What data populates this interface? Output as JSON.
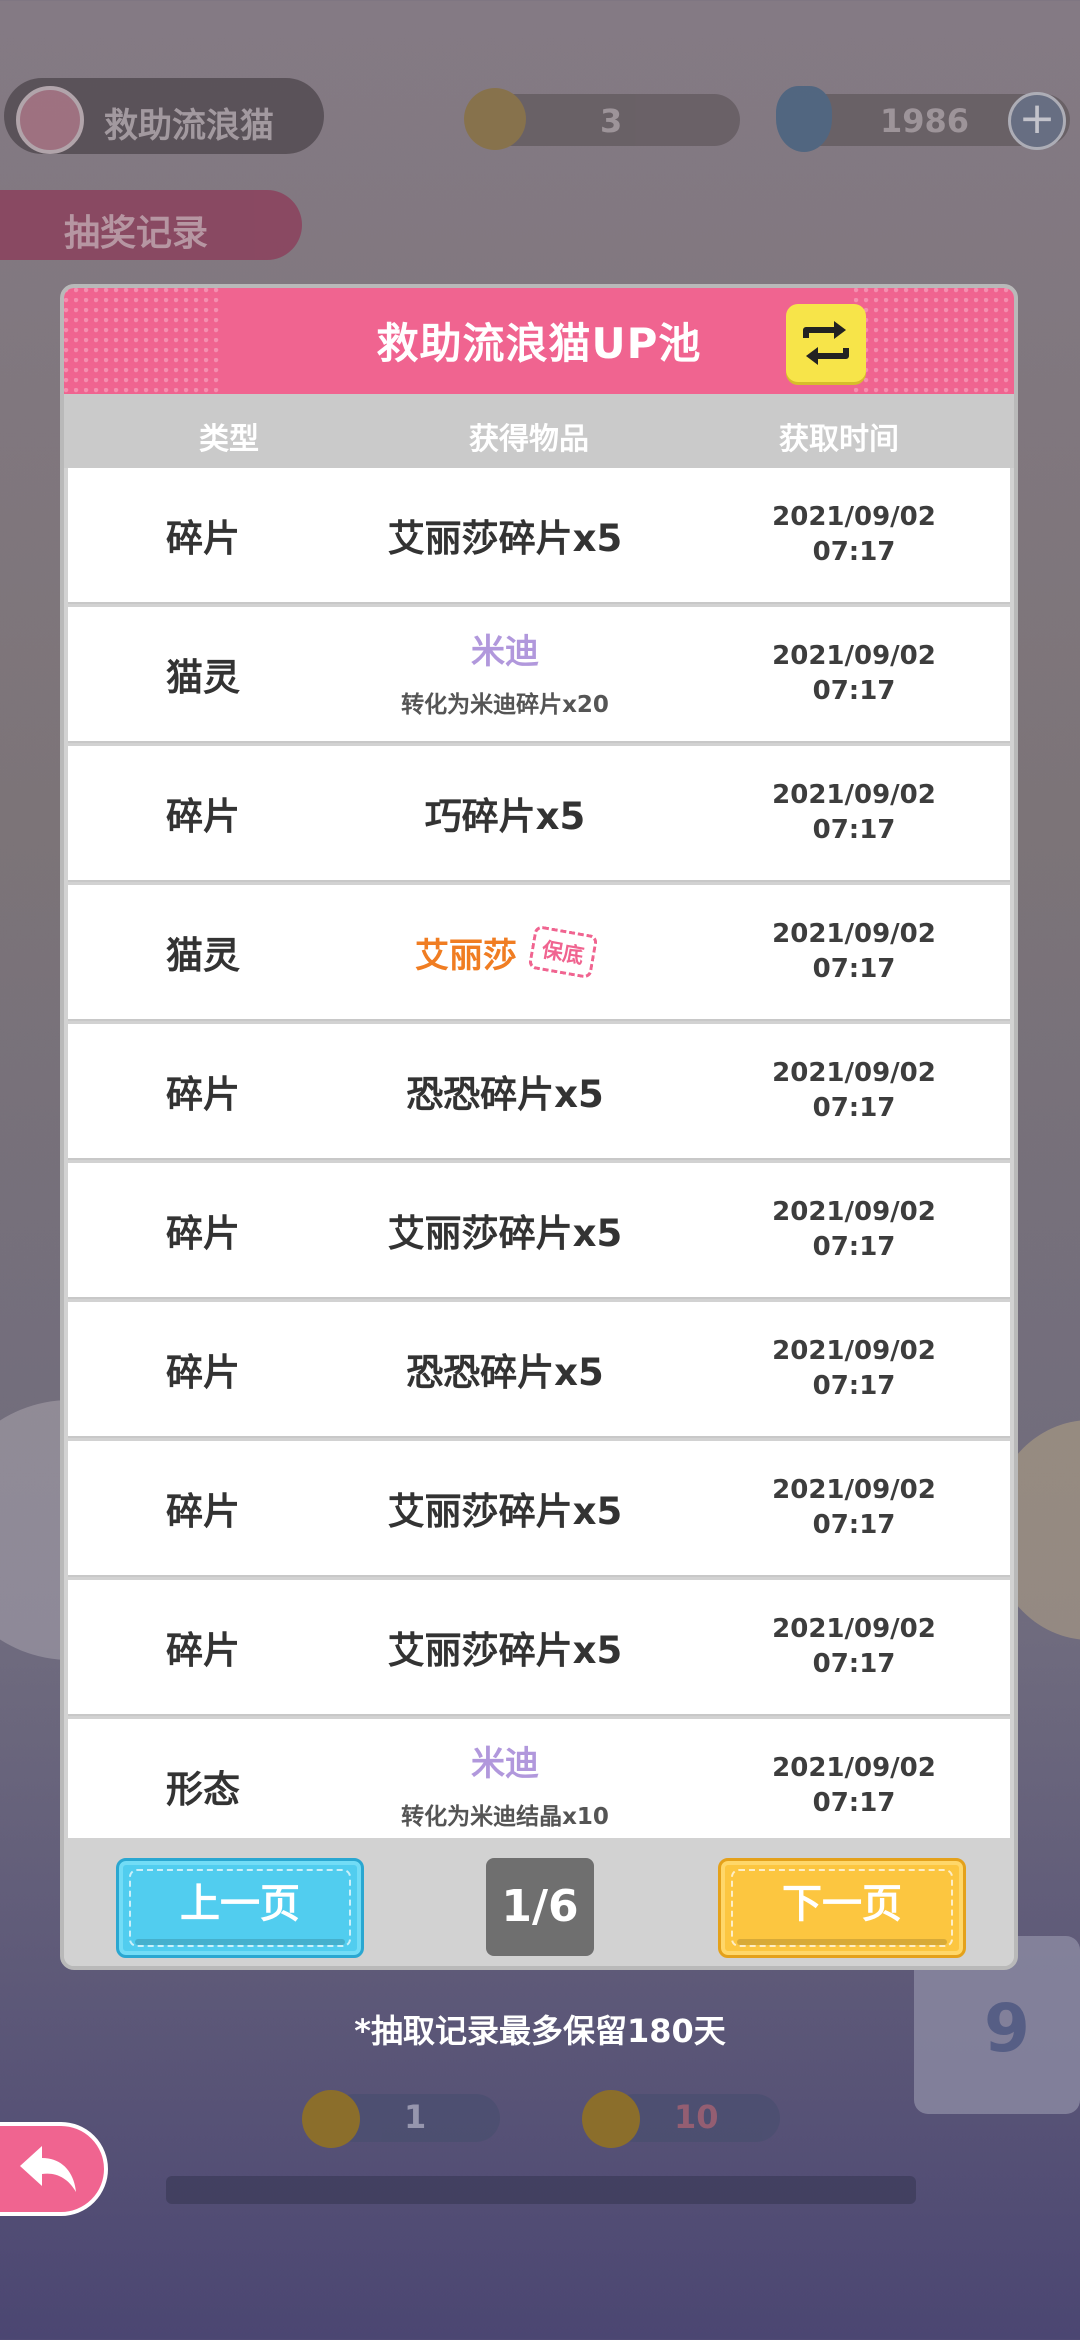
{
  "background": {
    "top_left_label": "救助流浪猫",
    "coin_count": "3",
    "gem_count": "1986",
    "record_button": "抽奖记录",
    "right_card_number": "9",
    "bottom_left_count": "1",
    "bottom_right_count": "10"
  },
  "modal": {
    "title": "救助流浪猫UP池",
    "columns": {
      "type": "类型",
      "item": "获得物品",
      "time": "获取时间"
    },
    "rows": [
      {
        "type": "碎片",
        "item": "艾丽莎碎片x5",
        "date": "2021/09/02",
        "time": "07:17"
      },
      {
        "type": "猫灵",
        "item": "米迪",
        "sub": "转化为米迪碎片x20",
        "date": "2021/09/02",
        "time": "07:17"
      },
      {
        "type": "碎片",
        "item": "巧碎片x5",
        "date": "2021/09/02",
        "time": "07:17"
      },
      {
        "type": "猫灵",
        "item": "艾丽莎",
        "badge": "保底",
        "date": "2021/09/02",
        "time": "07:17"
      },
      {
        "type": "碎片",
        "item": "恐恐碎片x5",
        "date": "2021/09/02",
        "time": "07:17"
      },
      {
        "type": "碎片",
        "item": "艾丽莎碎片x5",
        "date": "2021/09/02",
        "time": "07:17"
      },
      {
        "type": "碎片",
        "item": "恐恐碎片x5",
        "date": "2021/09/02",
        "time": "07:17"
      },
      {
        "type": "碎片",
        "item": "艾丽莎碎片x5",
        "date": "2021/09/02",
        "time": "07:17"
      },
      {
        "type": "碎片",
        "item": "艾丽莎碎片x5",
        "date": "2021/09/02",
        "time": "07:17"
      },
      {
        "type": "形态",
        "item": "米迪",
        "sub": "转化为米迪结晶x10",
        "date": "2021/09/02",
        "time": "07:17"
      }
    ],
    "prev_label": "上一页",
    "next_label": "下一页",
    "page_indicator": "1/6"
  },
  "note": "*抽取记录最多保留180天",
  "colors": {
    "header_pink": "#f06490",
    "switch_yellow": "#f7e449",
    "prev_blue": "#51cdef",
    "next_yellow": "#fcc640",
    "rare_purple": "#b198dc",
    "legend_orange": "#f07d22"
  },
  "icons": {
    "switch": "swap-arrows-icon",
    "back": "return-arrow-icon"
  }
}
